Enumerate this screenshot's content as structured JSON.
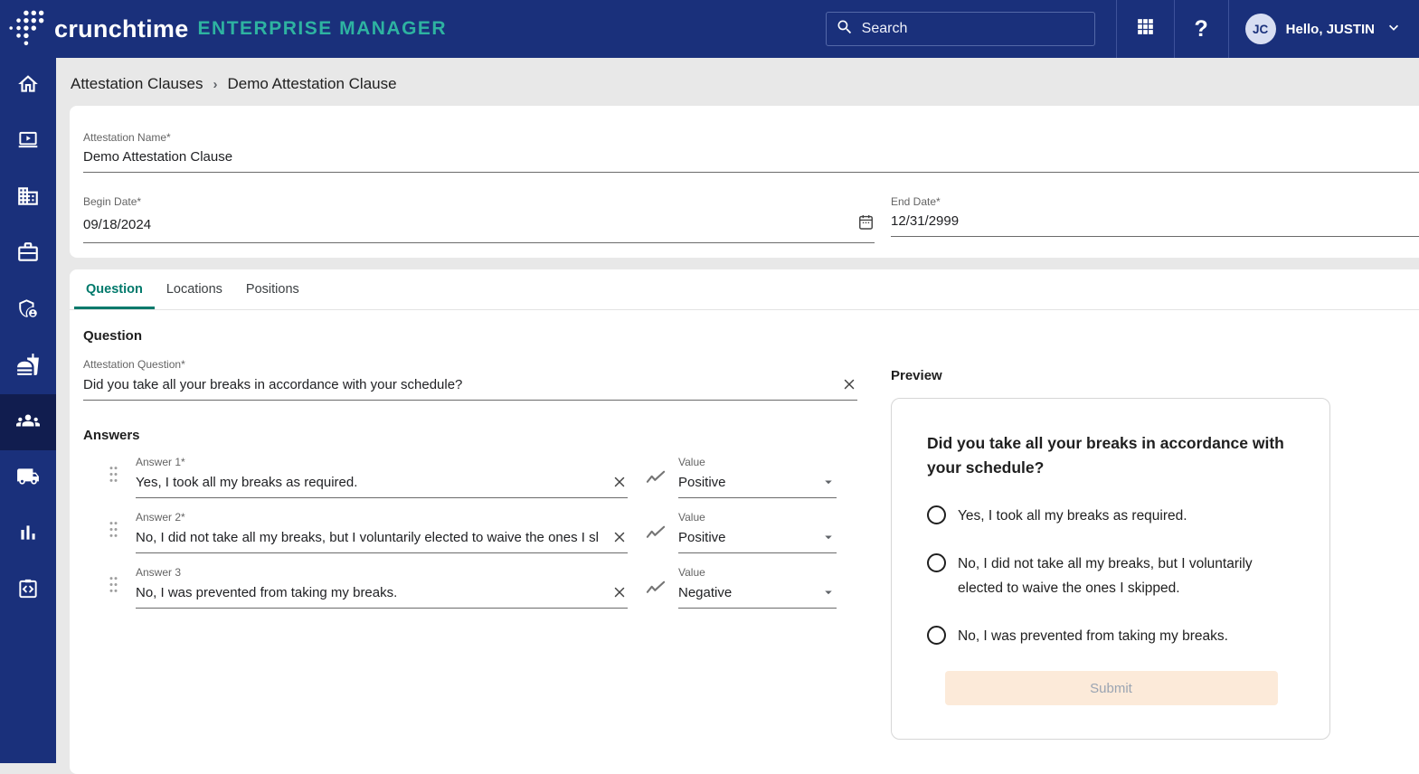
{
  "navbar": {
    "brand": "crunchtime",
    "brand_suffix": "ENTERPRISE MANAGER",
    "search_placeholder": "Search",
    "avatar_initials": "JC",
    "greeting": "Hello, JUSTIN",
    "icons": [
      "crunchtime-logo-icon",
      "search-icon",
      "apps-grid-icon",
      "help-icon",
      "chevron-down-icon"
    ]
  },
  "sidebar": {
    "items": [
      {
        "icon": "home-icon",
        "active": false
      },
      {
        "icon": "training-laptop-icon",
        "active": false
      },
      {
        "icon": "locations-building-icon",
        "active": false
      },
      {
        "icon": "toolbox-icon",
        "active": false
      },
      {
        "icon": "security-shield-user-icon",
        "active": false
      },
      {
        "icon": "food-service-icon",
        "active": false
      },
      {
        "icon": "labor-people-icon",
        "active": true
      },
      {
        "icon": "delivery-truck-icon",
        "active": false
      },
      {
        "icon": "reports-bar-chart-icon",
        "active": false
      },
      {
        "icon": "integrations-clipboard-code-icon",
        "active": false
      }
    ]
  },
  "breadcrumb": {
    "separator": "›",
    "items": [
      "Attestation Clauses",
      "Demo Attestation Clause"
    ]
  },
  "form": {
    "attestation_name": {
      "label": "Attestation Name*",
      "value": "Demo Attestation Clause"
    },
    "begin_date": {
      "label": "Begin Date*",
      "value": "09/18/2024"
    },
    "end_date": {
      "label": "End Date*",
      "value": "12/31/2999"
    }
  },
  "tabs": [
    {
      "label": "Question",
      "active": true
    },
    {
      "label": "Locations",
      "active": false
    },
    {
      "label": "Positions",
      "active": false
    }
  ],
  "question_section": {
    "heading": "Question",
    "question": {
      "label": "Attestation Question*",
      "value": "Did you take all your breaks in accordance with your schedule?"
    },
    "answers_heading": "Answers",
    "answers": [
      {
        "label": "Answer 1*",
        "value": "Yes, I took all my breaks as required.",
        "value_label": "Value",
        "value_option": "Positive"
      },
      {
        "label": "Answer 2*",
        "value": "No, I did not take all my breaks, but I voluntarily elected to waive the ones I sl",
        "value_label": "Value",
        "value_option": "Positive"
      },
      {
        "label": "Answer 3",
        "value": "No, I was prevented from taking my breaks.",
        "value_label": "Value",
        "value_option": "Negative"
      }
    ]
  },
  "preview": {
    "heading": "Preview",
    "question": "Did you take all your breaks in accordance with your schedule?",
    "options": [
      "Yes, I took all my breaks as required.",
      "No, I did not take all my breaks, but I voluntarily elected to waive the ones I skipped.",
      "No, I was prevented from taking my breaks."
    ],
    "submit_label": "Submit"
  },
  "colors": {
    "navbar_bg": "#1a307b",
    "sidebar_active_bg": "#111d4f",
    "brand_teal": "#2eb3a1",
    "tab_active_teal": "#00796b",
    "page_bg": "#e8e8e8",
    "submit_bg": "#fcead9",
    "submit_text": "#9aa4b2"
  }
}
